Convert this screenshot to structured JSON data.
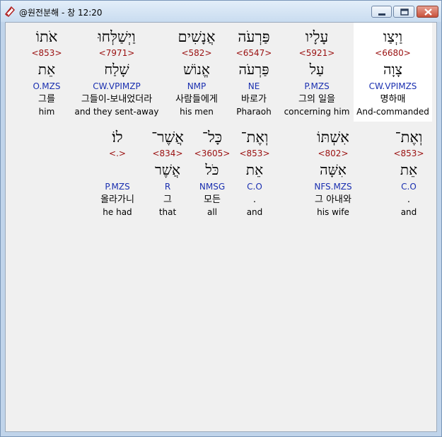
{
  "window": {
    "title": "@원전분해 - 창 12:20"
  },
  "colors": {
    "strong": "#9a1010",
    "morph": "#1a2fb0",
    "highlight": "#ffffff"
  },
  "row1": [
    {
      "heb": "וַיְצַו",
      "strong": "<6680>",
      "lemma": "צָוָה",
      "morph": "CW.VPIMZS",
      "kor": "명하매",
      "eng": "And-commanded"
    },
    {
      "heb": "עָלָיו",
      "strong": "<5921>",
      "lemma": "עַל",
      "morph": "P.MZS",
      "kor": "그의 일을",
      "eng": "concerning him"
    },
    {
      "heb": "פַּרְעֹה",
      "strong": "<6547>",
      "lemma": "פַּרְעֹה",
      "morph": "NE",
      "kor": "바로가",
      "eng": "Pharaoh"
    },
    {
      "heb": "אֲנָשִׁים",
      "strong": "<582>",
      "lemma": "אֱנוֹשׁ",
      "morph": "NMP",
      "kor": "사람들에게",
      "eng": "his men"
    },
    {
      "heb": "וַיְשַׁלְּחוּ",
      "strong": "<7971>",
      "lemma": "שָׁלַח",
      "morph": "CW.VPIMZP",
      "kor": "그들이-보내었더라",
      "eng": "and they sent-away"
    },
    {
      "heb": "אֹתוֹ",
      "strong": "<853>",
      "lemma": "אֵת",
      "morph": "O.MZS",
      "kor": "그를",
      "eng": "him"
    }
  ],
  "row2": [
    {
      "heb": "וְאֶת־",
      "strong": "<853>",
      "lemma": "אֵת",
      "morph": "C.O",
      "kor": ".",
      "eng": "and"
    },
    {
      "heb": "אִשְׁתּוֹ",
      "strong": "<802>",
      "lemma": "אִשָּׁה",
      "morph": "NFS.MZS",
      "kor": "그 아내와",
      "eng": "his wife"
    },
    {
      "heb": "וְאֶת־",
      "strong": "<853>",
      "lemma": "אֵת",
      "morph": "C.O",
      "kor": ".",
      "eng": "and"
    },
    {
      "heb": "כָּל־",
      "strong": "<3605>",
      "lemma": "כֹּל",
      "morph": "NMSG",
      "kor": "모든",
      "eng": "all"
    },
    {
      "heb": "אֲשֶׁר־",
      "strong": "<834>",
      "lemma": "אֲשֶׁר",
      "morph": "R",
      "kor": "그",
      "eng": "that"
    },
    {
      "heb": "לוֹ׃",
      "strong": "<.>",
      "lemma": "",
      "morph": "P.MZS",
      "kor": "올라가니",
      "eng": "he had"
    }
  ]
}
